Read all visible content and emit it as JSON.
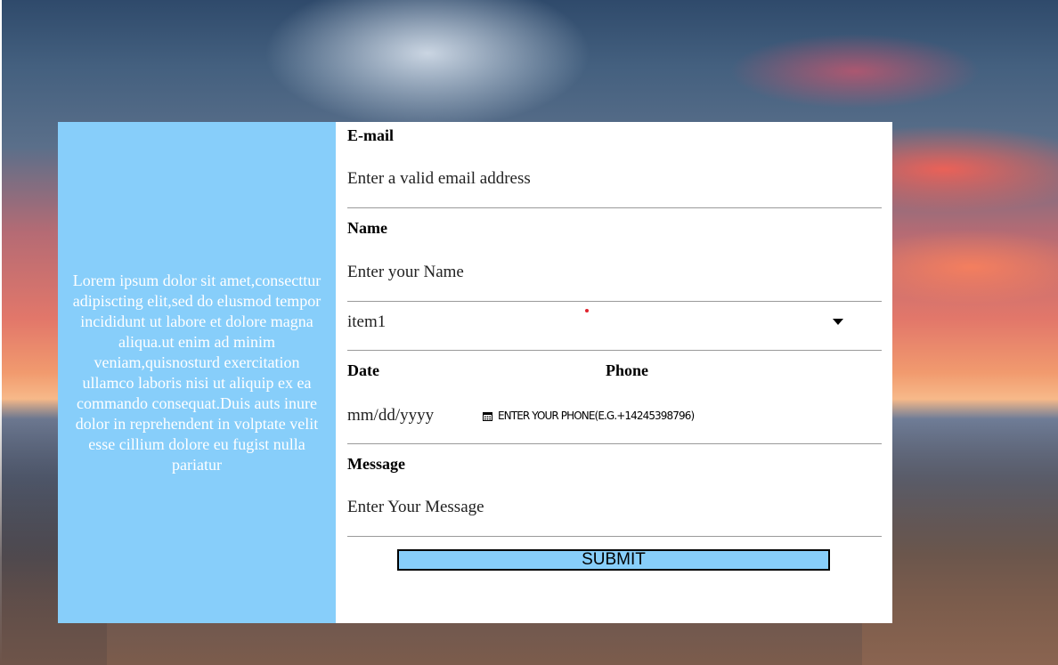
{
  "intro": {
    "text": "Lorem ipsum dolor sit amet,consecttur adipiscting elit,sed do elusmod tempor incididunt ut labore et dolore magna aliqua.ut enim ad minim veniam,quisnosturd exercitation ullamco laboris nisi ut aliquip ex ea commando consequat.Duis auts inure dolor in reprehendent in volptate velit esse cillium dolore eu fugist nulla pariatur"
  },
  "form": {
    "email": {
      "label": "E-mail",
      "placeholder": "Enter a valid email address"
    },
    "name": {
      "label": "Name",
      "placeholder": "Enter your Name"
    },
    "select": {
      "value": "item1",
      "icon": "caret-down-icon"
    },
    "date": {
      "label": "Date",
      "placeholder": "mm/dd/yyyy",
      "icon": "calendar-icon"
    },
    "phone": {
      "label": "Phone",
      "placeholder": "ENTER YOUR PHONE(E.G.+14245398796)"
    },
    "message": {
      "label": "Message",
      "placeholder": "Enter Your Message"
    },
    "submit_label": "SUBMIT"
  },
  "colors": {
    "panel_blue": "#87cefa",
    "form_bg": "#ffffff",
    "accent_dot": "#e0232d"
  }
}
